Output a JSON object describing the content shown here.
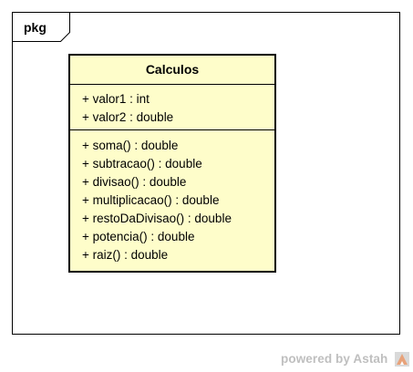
{
  "package": {
    "label": "pkg"
  },
  "class": {
    "name": "Calculos",
    "attributes": [
      "+ valor1 : int",
      "+ valor2 : double"
    ],
    "operations": [
      "+ soma() : double",
      "+ subtracao() : double",
      "+ divisao() : double",
      "+ multiplicacao() : double",
      "+ restoDaDivisao() : double",
      "+ potencia() : double",
      "+ raiz() : double"
    ]
  },
  "footer": {
    "text": "powered by Astah"
  },
  "colors": {
    "class_fill": "#fefdca",
    "border": "#000000",
    "footer_text": "#bfbfbf",
    "logo_accent": "#e8a27a"
  },
  "icons": {
    "logo": "astah-logo-icon"
  }
}
